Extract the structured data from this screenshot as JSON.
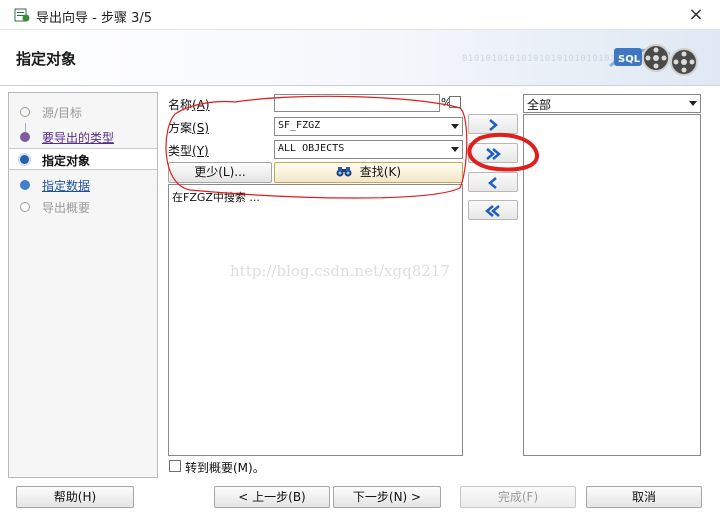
{
  "window": {
    "title": "导出向导 - 步骤 3/5",
    "close_symbol": "×"
  },
  "header": {
    "title": "指定对象",
    "binary_text": "01010101010101010101010101"
  },
  "steps": [
    {
      "label": "源/目标",
      "state": "done"
    },
    {
      "label": "要导出的类型",
      "state": "visited"
    },
    {
      "label": "指定对象",
      "state": "current"
    },
    {
      "label": "指定数据",
      "state": "next"
    },
    {
      "label": "导出概要",
      "state": "future"
    }
  ],
  "form": {
    "name_label": "名称",
    "name_key": "(A)",
    "name_value": "",
    "percent": "%",
    "schema_label": "方案",
    "schema_key": "(S)",
    "schema_value": "SF_FZGZ",
    "type_label": "类型",
    "type_key": "(Y)",
    "type_value": "ALL OBJECTS",
    "less_button": "更少(L)...",
    "find_button": "查找(K)",
    "search_result": "在FZGZ中搜索 ..."
  },
  "transfer": {
    "icons": [
      "chevron-right-icon",
      "double-chevron-right-icon",
      "chevron-left-icon",
      "double-chevron-left-icon"
    ]
  },
  "target": {
    "filter_value": "全部"
  },
  "summary": {
    "label": "转到概要(M)。"
  },
  "buttons": {
    "help": "帮助(H)",
    "back": "< 上一步(B)",
    "next": "下一步(N) >",
    "finish": "完成(F)",
    "cancel": "取消"
  },
  "watermark": "http://blog.csdn.net/xgq8217",
  "colors": {
    "accent_blue": "#2c5fa8",
    "visited_purple": "#5a2c8a",
    "arrow_blue": "#1f5fc0"
  }
}
